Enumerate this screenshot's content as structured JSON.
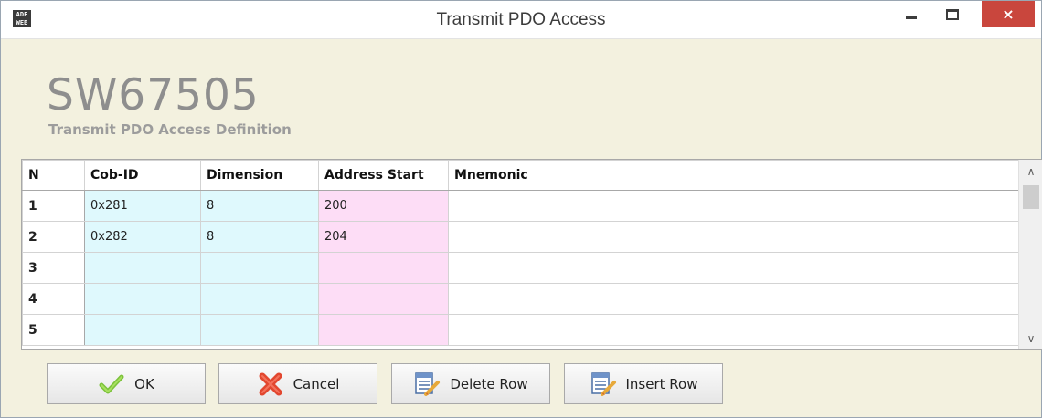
{
  "window": {
    "title": "Transmit PDO Access",
    "app_icon_text": "ADF WEB",
    "min_glyph": "minimize-icon",
    "max_glyph": "maximize-icon",
    "close_glyph": "×"
  },
  "header": {
    "title": "SW67505",
    "subtitle": "Transmit PDO Access Definition"
  },
  "table": {
    "columns": [
      "N",
      "Cob-ID",
      "Dimension",
      "Address Start",
      "Mnemonic"
    ],
    "rows": [
      {
        "n": "1",
        "cob_id": "0x281",
        "dimension": "8",
        "address_start": "200",
        "mnemonic": ""
      },
      {
        "n": "2",
        "cob_id": "0x282",
        "dimension": "8",
        "address_start": "204",
        "mnemonic": ""
      },
      {
        "n": "3",
        "cob_id": "",
        "dimension": "",
        "address_start": "",
        "mnemonic": ""
      },
      {
        "n": "4",
        "cob_id": "",
        "dimension": "",
        "address_start": "",
        "mnemonic": ""
      },
      {
        "n": "5",
        "cob_id": "",
        "dimension": "",
        "address_start": "",
        "mnemonic": ""
      }
    ],
    "colors": {
      "cyan": "#dff9fd",
      "pink": "#fdddf6"
    }
  },
  "buttons": {
    "ok": "OK",
    "cancel": "Cancel",
    "delete_row": "Delete Row",
    "insert_row": "Insert Row"
  },
  "icons": {
    "ok": "checkmark-icon",
    "cancel": "red-x-icon",
    "delete_row": "delete-row-icon",
    "insert_row": "insert-row-icon"
  }
}
